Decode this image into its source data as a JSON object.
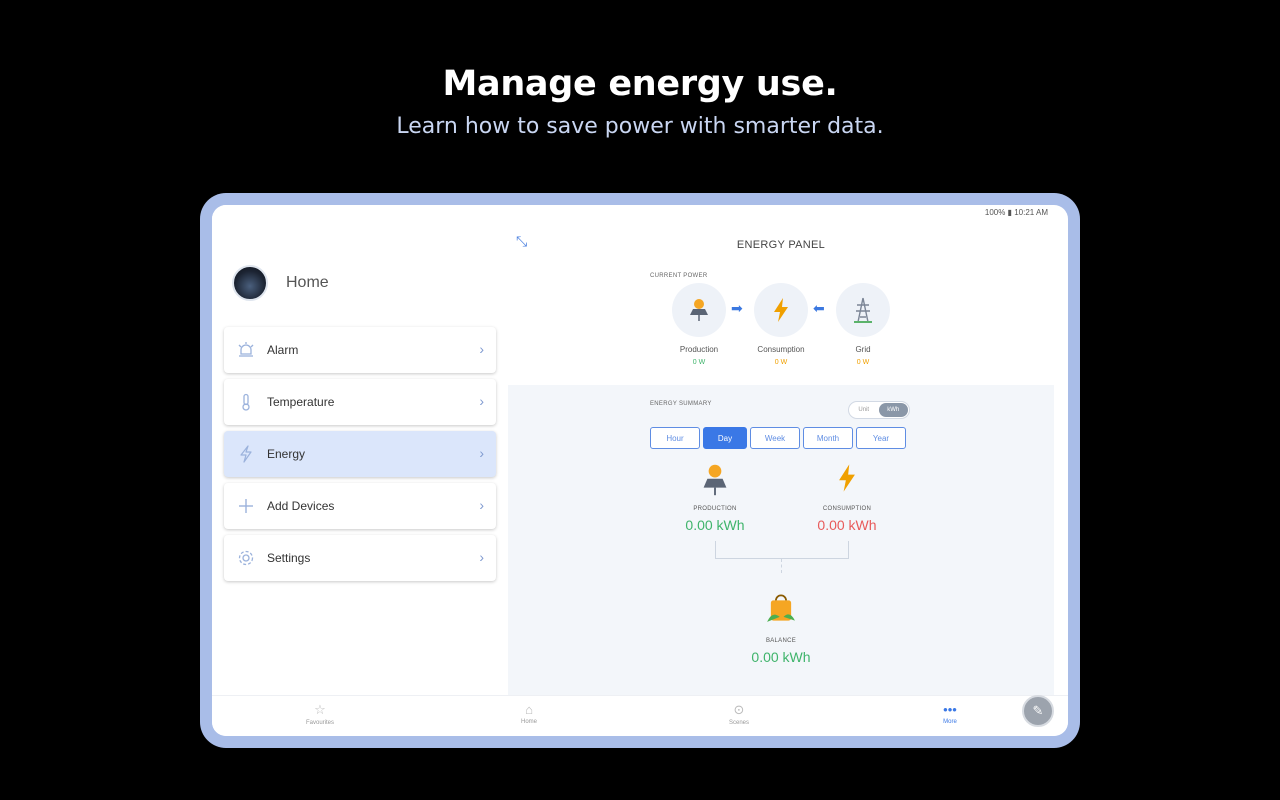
{
  "headline": "Manage energy use.",
  "subline": "Learn how to save power with smarter data.",
  "statusbar": {
    "right": "100% ▮ 10:21 AM"
  },
  "sidebar": {
    "home_label": "Home",
    "items": [
      {
        "label": "Alarm",
        "icon": "alarm-icon"
      },
      {
        "label": "Temperature",
        "icon": "thermometer-icon"
      },
      {
        "label": "Energy",
        "icon": "lightning-icon"
      },
      {
        "label": "Add Devices",
        "icon": "plus-icon"
      },
      {
        "label": "Settings",
        "icon": "gear-icon"
      }
    ]
  },
  "panel": {
    "title": "ENERGY PANEL",
    "current_power_label": "CURRENT POWER",
    "flow": {
      "production": {
        "label": "Production",
        "value": "0 W"
      },
      "consumption": {
        "label": "Consumption",
        "value": "0 W"
      },
      "grid": {
        "label": "Grid",
        "value": "0 W"
      }
    },
    "summary_label": "ENERGY SUMMARY",
    "unit_toggle": {
      "off": "Unit",
      "on": "kWh"
    },
    "periods": [
      "Hour",
      "Day",
      "Week",
      "Month",
      "Year"
    ],
    "production": {
      "label": "PRODUCTION",
      "value": "0.00 kWh"
    },
    "consumption": {
      "label": "CONSUMPTION",
      "value": "0.00 kWh"
    },
    "balance": {
      "label": "BALANCE",
      "value": "0.00 kWh"
    }
  },
  "bottomnav": {
    "items": [
      "Favourites",
      "Home",
      "Scenes",
      "More"
    ]
  },
  "colors": {
    "accent": "#3a78e6",
    "production": "#3fb46b",
    "consumption": "#e85b5b",
    "frame": "#a9bde8"
  }
}
